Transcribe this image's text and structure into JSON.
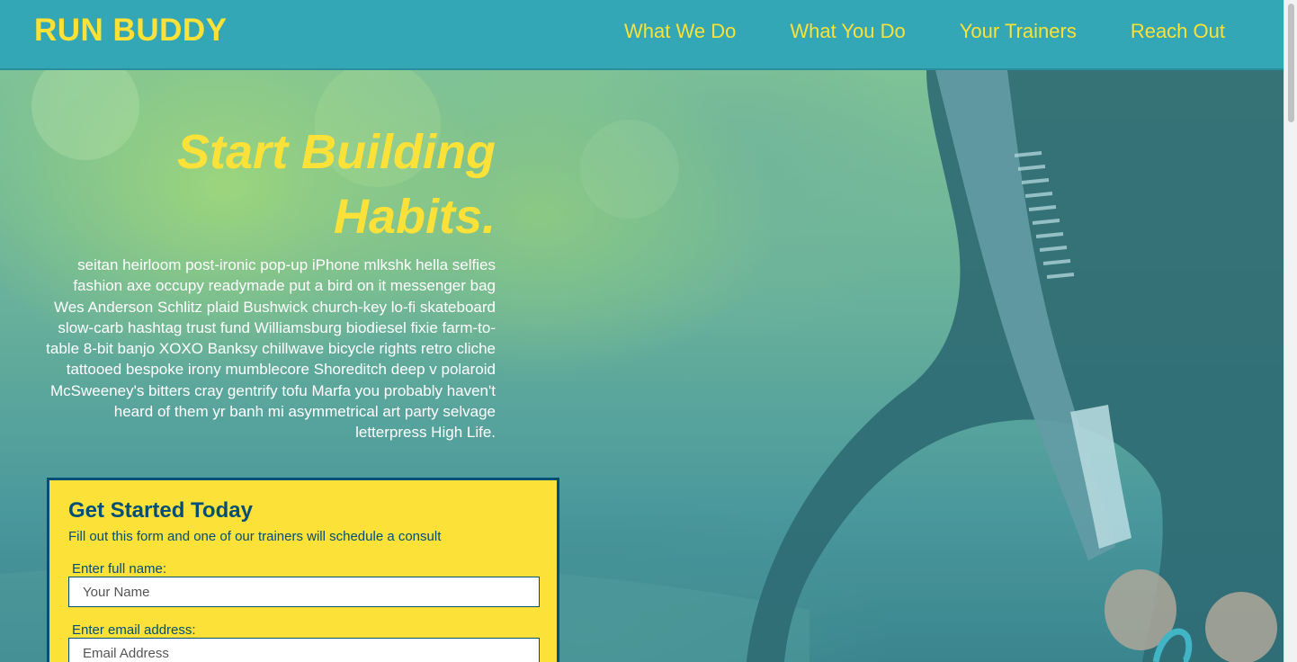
{
  "header": {
    "brand": "RUN BUDDY",
    "nav": [
      "What We Do",
      "What You Do",
      "Your Trainers",
      "Reach Out"
    ]
  },
  "hero": {
    "title_line1": "Start Building",
    "title_line2": "Habits.",
    "body": "seitan heirloom post-ironic pop-up iPhone mlkshk hella selfies fashion axe occupy readymade put a bird on it messenger bag Wes Anderson Schlitz plaid Bushwick church-key lo-fi skateboard slow-carb hashtag trust fund Williamsburg biodiesel fixie farm-to-table 8-bit banjo XOXO Banksy chillwave bicycle rights retro cliche tattooed bespoke irony mumblecore Shoreditch deep v polaroid McSweeney's bitters cray gentrify tofu Marfa you probably haven't heard of them yr banh mi asymmetrical art party selvage letterpress High Life."
  },
  "form": {
    "title": "Get Started Today",
    "subtitle": "Fill out this form and one of our trainers will schedule a consult",
    "name_label": "Enter full name:",
    "name_placeholder": "Your Name",
    "email_label": "Enter email address:",
    "email_placeholder": "Email Address"
  },
  "colors": {
    "header_bg": "#33a7b5",
    "accent_yellow": "#fce138",
    "navy": "#024e76"
  }
}
